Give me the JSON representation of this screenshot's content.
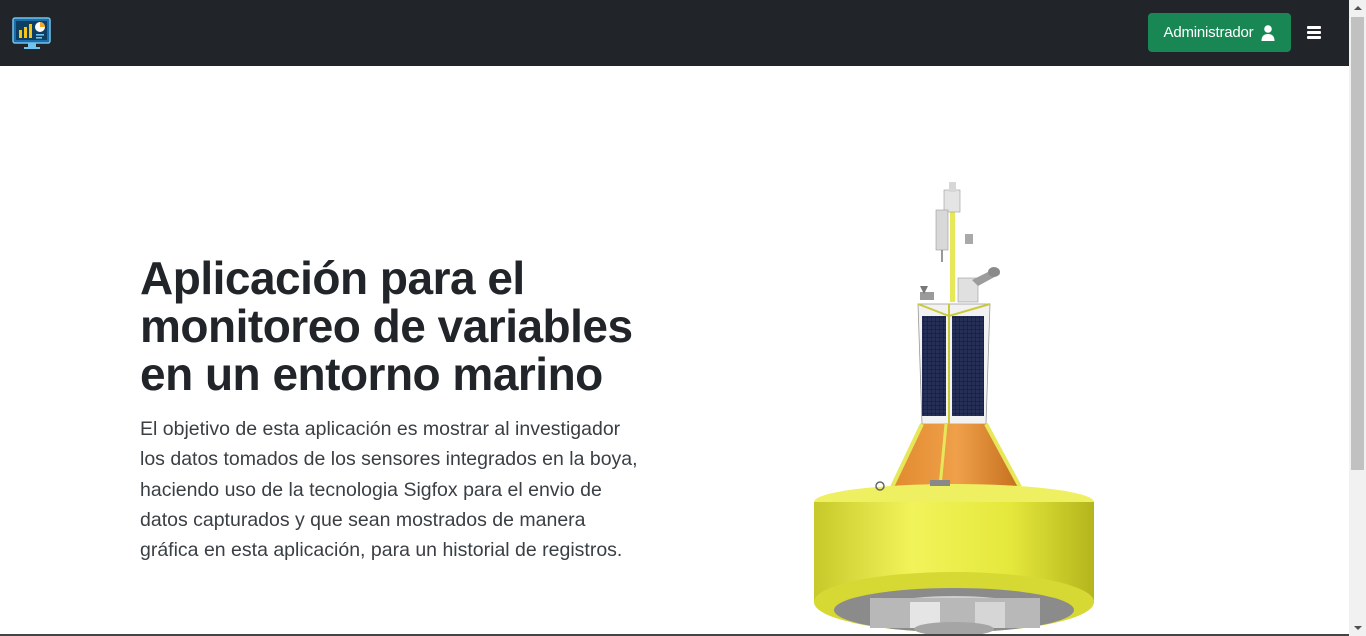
{
  "navbar": {
    "logo_icon": "monitor-chart-logo-icon",
    "admin_button_label": "Administrador",
    "admin_button_icon": "user-icon",
    "menu_icon": "hamburger-menu-icon",
    "colors": {
      "background": "#212529",
      "admin_button": "#198754"
    }
  },
  "hero": {
    "title_lines": [
      "Aplicación para el",
      "monitoreo de variables",
      "en un entorno marino"
    ],
    "lead_lines": [
      "El objetivo de esta aplicación es mostrar al investigador",
      "los datos tomados de los sensores integrados en la boya,",
      "haciendo uso de la tecnologia Sigfox para el envio de",
      "datos capturados y que sean mostrados de manera",
      "gráfica en esta aplicación, para un historial de registros."
    ],
    "image": "ocean-buoy-illustration"
  }
}
